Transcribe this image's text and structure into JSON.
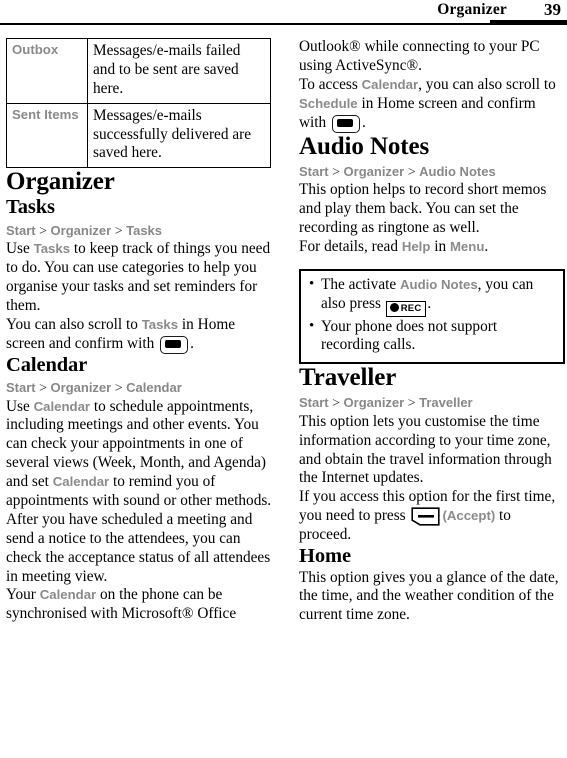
{
  "header": {
    "title": "Organizer",
    "page_number": "39"
  },
  "table": {
    "rows": [
      {
        "label": "Outbox",
        "description": "Messages/e-mails failed and to be sent are saved here."
      },
      {
        "label": "Sent Items",
        "description": "Messages/e-mails successfully delivered are saved here."
      }
    ]
  },
  "left_column": {
    "chapter_title": "Organizer",
    "tasks": {
      "heading": "Tasks",
      "breadcrumb": [
        "Start",
        "Organizer",
        "Tasks"
      ],
      "p1_a": "Use ",
      "p1_ui": "Tasks",
      "p1_b": " to keep track of things you need to do. You can use categories to help you organise your tasks and set reminders for them.",
      "p2_a": "You can also scroll to ",
      "p2_ui": "Tasks",
      "p2_b": " in Home screen and confirm with ",
      "p2_c": "."
    },
    "calendar": {
      "heading": "Calendar",
      "breadcrumb": [
        "Start",
        "Organizer",
        "Calendar"
      ],
      "p1_a": "Use ",
      "p1_ui1": "Calendar",
      "p1_b": " to schedule appointments, including meetings and other events. You can check your appointments in one of several views (Week, Month, and Agenda) and set ",
      "p1_ui2": "Calendar",
      "p1_c": " to remind you of appointments with sound or other methods.",
      "p2": "After you have scheduled a meeting and send a notice to the attendees, you can check the acceptance status of all attendees in meeting view.",
      "p3_a": "Your ",
      "p3_ui": "Calendar",
      "p3_b": " on the phone can be synchronised with Microsoft® Office"
    }
  },
  "right_column": {
    "continued": {
      "p1": "Outlook® while connecting to your PC using ActiveSync®.",
      "p2_a": "To access ",
      "p2_ui1": "Calendar",
      "p2_b": ", you can also scroll to ",
      "p2_ui2": "Schedule",
      "p2_c": " in Home screen and confirm with ",
      "p2_d": "."
    },
    "audio_notes": {
      "heading": "Audio Notes",
      "breadcrumb": [
        "Start",
        "Organizer",
        "Audio Notes"
      ],
      "p1": "This option helps to record short memos and play them back. You can set the recording as ringtone as well.",
      "p2_a": "For details, read ",
      "p2_ui1": "Help",
      "p2_b": " in ",
      "p2_ui2": "Menu",
      "p2_c": ".",
      "note_box": {
        "bullet1_a": "The activate ",
        "bullet1_ui": "Audio Notes",
        "bullet1_b": ", you can also press ",
        "bullet1_key": "REC",
        "bullet1_c": ".",
        "bullet2": "Your phone does not support recording calls."
      }
    },
    "traveller": {
      "heading": "Traveller",
      "breadcrumb": [
        "Start",
        "Organizer",
        "Traveller"
      ],
      "p1": "This option lets you customise the time information according to your time zone, and obtain the travel information through the Internet updates.",
      "p2_a": "If you access this option for the first time, you need to press ",
      "p2_accept": "(Accept)",
      "p2_b": " to proceed."
    },
    "home": {
      "heading": "Home",
      "p1": "This option gives you a glance of the date, the time, and the weather condition of the current time zone."
    }
  }
}
